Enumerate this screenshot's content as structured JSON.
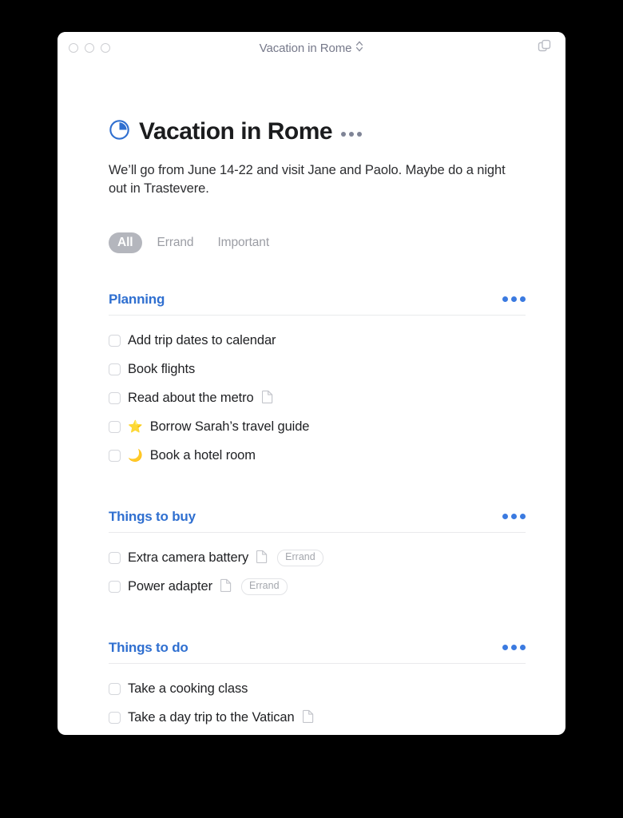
{
  "window": {
    "title": "Vacation in Rome",
    "title_chevron_icon": "chevron-up-down-icon",
    "duplicate_icon": "duplicate-window-icon",
    "traffic_lights": [
      "close",
      "minimize",
      "zoom"
    ]
  },
  "document": {
    "status_icon": "pie-progress-icon",
    "title": "Vacation in Rome",
    "menu_icon": "ellipsis-icon",
    "description": "We’ll go from June 14-22 and visit Jane and Paolo. Maybe do a night out in Trastevere."
  },
  "filters": {
    "items": [
      {
        "label": "All",
        "active": true
      },
      {
        "label": "Errand",
        "active": false
      },
      {
        "label": "Important",
        "active": false
      }
    ]
  },
  "sections": [
    {
      "title": "Planning",
      "menu_icon": "ellipsis-icon",
      "tasks": [
        {
          "text": "Add trip dates to calendar",
          "emoji": "",
          "note": false,
          "tag": ""
        },
        {
          "text": "Book flights",
          "emoji": "",
          "note": false,
          "tag": ""
        },
        {
          "text": "Read about the metro",
          "emoji": "",
          "note": true,
          "tag": ""
        },
        {
          "text": "Borrow Sarah’s travel guide",
          "emoji": "⭐",
          "note": false,
          "tag": ""
        },
        {
          "text": "Book a hotel room",
          "emoji": "🌙",
          "note": false,
          "tag": ""
        }
      ]
    },
    {
      "title": "Things to buy",
      "menu_icon": "ellipsis-icon",
      "tasks": [
        {
          "text": "Extra camera battery",
          "emoji": "",
          "note": true,
          "tag": "Errand"
        },
        {
          "text": "Power adapter",
          "emoji": "",
          "note": true,
          "tag": "Errand"
        }
      ]
    },
    {
      "title": "Things to do",
      "menu_icon": "ellipsis-icon",
      "tasks": [
        {
          "text": "Take a cooking class",
          "emoji": "",
          "note": false,
          "tag": ""
        },
        {
          "text": "Take a day trip to the Vatican",
          "emoji": "",
          "note": true,
          "tag": ""
        }
      ]
    }
  ],
  "colors": {
    "accent_blue": "#3b7ae0",
    "section_title_blue": "#2f6fd0",
    "background": "#000000",
    "window": "#ffffff",
    "muted_gray": "#9b9da4",
    "pill_active_bg": "#b4b6bd"
  }
}
